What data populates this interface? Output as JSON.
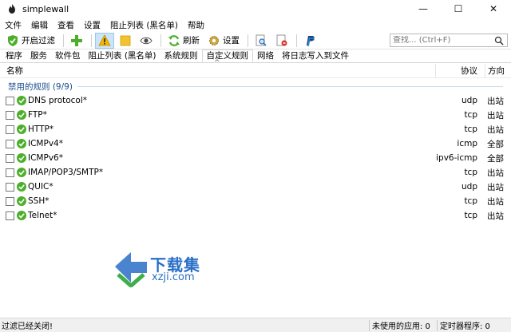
{
  "window": {
    "title": "simplewall",
    "minimize": "—",
    "maximize": "☐",
    "close": "✕"
  },
  "menu": [
    "文件",
    "编辑",
    "查看",
    "设置",
    "阻止列表 (黑名单)",
    "帮助"
  ],
  "toolbar": {
    "filter_label": "开启过滤",
    "refresh_label": "刷新",
    "settings_label": "设置"
  },
  "search": {
    "placeholder": "查找... (Ctrl+F)"
  },
  "tabs": [
    "程序",
    "服务",
    "软件包",
    "阻止列表 (黑名单)",
    "系统规则",
    "自定义规则",
    "网络",
    "将日志写入到文件"
  ],
  "columns": {
    "name": "名称",
    "protocol": "协议",
    "direction": "方向"
  },
  "group": {
    "label": "禁用的规则 (9/9)"
  },
  "rules": [
    {
      "name": "DNS protocol*",
      "protocol": "udp",
      "direction": "出站"
    },
    {
      "name": "FTP*",
      "protocol": "tcp",
      "direction": "出站"
    },
    {
      "name": "HTTP*",
      "protocol": "tcp",
      "direction": "出站"
    },
    {
      "name": "ICMPv4*",
      "protocol": "icmp",
      "direction": "全部"
    },
    {
      "name": "ICMPv6*",
      "protocol": "ipv6-icmp",
      "direction": "全部"
    },
    {
      "name": "IMAP/POP3/SMTP*",
      "protocol": "tcp",
      "direction": "出站"
    },
    {
      "name": "QUIC*",
      "protocol": "udp",
      "direction": "出站"
    },
    {
      "name": "SSH*",
      "protocol": "tcp",
      "direction": "出站"
    },
    {
      "name": "Telnet*",
      "protocol": "tcp",
      "direction": "出站"
    }
  ],
  "watermark": {
    "title": "下载集",
    "url": "xzji.com"
  },
  "status": {
    "filter_state": "过滤已经关闭!",
    "unused_apps": "未使用的应用: 0",
    "timers": "定时器程序: 0"
  },
  "colors": {
    "accent": "#1b4f8f",
    "ok_green": "#4caf2a",
    "selected_tab_bg": "#cce4f7"
  }
}
